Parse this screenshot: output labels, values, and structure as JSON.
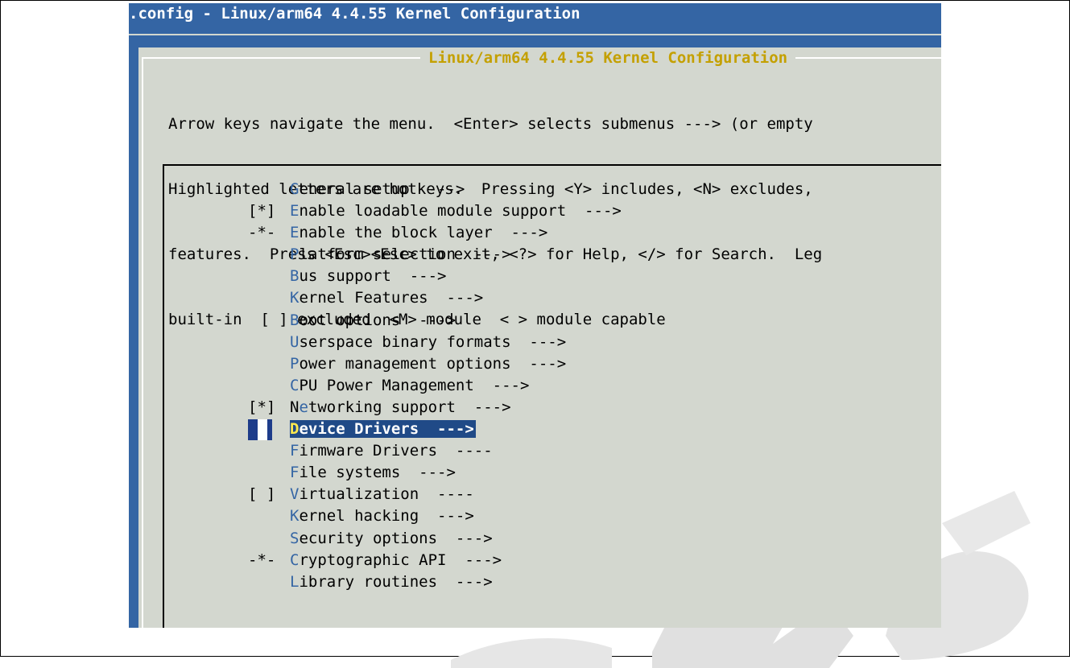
{
  "window": {
    "title": ".config - Linux/arm64 4.4.55 Kernel Configuration"
  },
  "dialog": {
    "title": "Linux/arm64 4.4.55 Kernel Configuration",
    "help_lines": [
      "Arrow keys navigate the menu.  <Enter> selects submenus ---> (or empty",
      "Highlighted letters are hotkeys.  Pressing <Y> includes, <N> excludes,",
      "features.  Press <Esc><Esc> to exit, <?> for Help, </> for Search.  Leg",
      "built-in  [ ] excluded  <M> module  < > module capable"
    ]
  },
  "menu": {
    "items": [
      {
        "prefix": "",
        "hotkey": "G",
        "rest": "eneral setup  --->"
      },
      {
        "prefix": "[*]",
        "hotkey": "E",
        "rest": "nable loadable module support  --->"
      },
      {
        "prefix": "-*-",
        "hotkey": "E",
        "rest": "nable the block layer  --->"
      },
      {
        "prefix": "",
        "hotkey": "P",
        "rest": "latform selection  --->"
      },
      {
        "prefix": "",
        "hotkey": "B",
        "rest": "us support  --->"
      },
      {
        "prefix": "",
        "hotkey": "K",
        "rest": "ernel Features  --->"
      },
      {
        "prefix": "",
        "hotkey": "B",
        "rest": "oot options  --->"
      },
      {
        "prefix": "",
        "hotkey": "U",
        "rest": "serspace binary formats  --->"
      },
      {
        "prefix": "",
        "hotkey": "P",
        "rest": "ower management options  --->"
      },
      {
        "prefix": "",
        "hotkey": "C",
        "rest": "PU Power Management  --->"
      },
      {
        "prefix": "[*]",
        "hotkey": "Ne",
        "rest": "tworking support  --->",
        "hotkey_index": 1
      },
      {
        "prefix": "",
        "hotkey": "D",
        "rest": "evice Drivers  --->",
        "selected": true
      },
      {
        "prefix": "",
        "hotkey": "F",
        "rest": "irmware Drivers  ----"
      },
      {
        "prefix": "",
        "hotkey": "F",
        "rest": "ile systems  --->"
      },
      {
        "prefix": "[ ]",
        "hotkey": "V",
        "rest": "irtualization  ----"
      },
      {
        "prefix": "",
        "hotkey": "K",
        "rest": "ernel hacking  --->"
      },
      {
        "prefix": "",
        "hotkey": "S",
        "rest": "ecurity options  --->"
      },
      {
        "prefix": "-*-",
        "hotkey": "C",
        "rest": "ryptographic API  --->"
      },
      {
        "prefix": "",
        "hotkey": "L",
        "rest": "ibrary routines  --->"
      }
    ]
  },
  "colors": {
    "terminal_bg": "#3465a4",
    "dialog_bg": "#d3d7cf",
    "hotkey": "#3465a4",
    "title_text": "#c4a000",
    "selection_bg": "#204a87",
    "selection_hotkey": "#fce94f"
  }
}
